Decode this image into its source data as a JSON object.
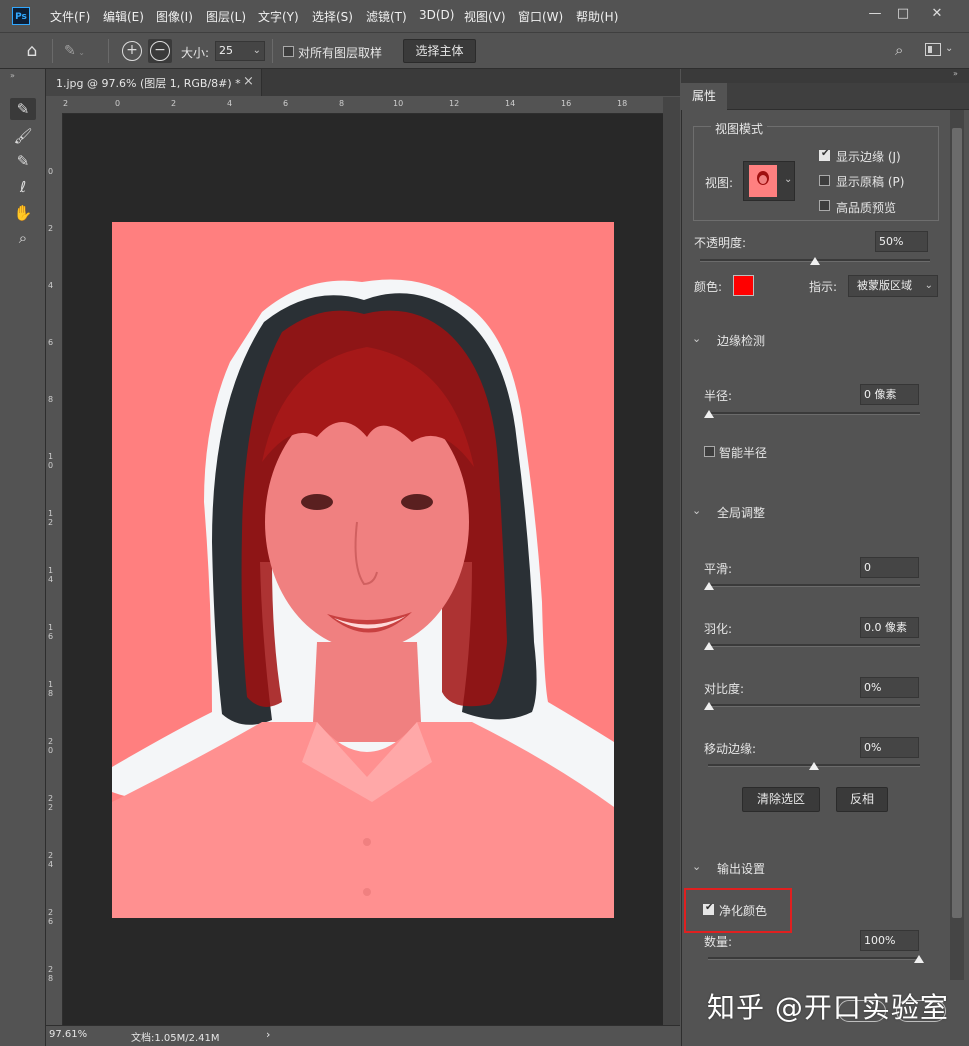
{
  "menu": {
    "items": [
      "文件(F)",
      "编辑(E)",
      "图像(I)",
      "图层(L)",
      "文字(Y)",
      "选择(S)",
      "滤镜(T)",
      "3D(D)",
      "视图(V)",
      "窗口(W)",
      "帮助(H)"
    ],
    "logo": "Ps"
  },
  "options": {
    "size_label": "大小:",
    "size_value": "25",
    "sample_all_layers": "对所有图层取样",
    "select_subject": "选择主体"
  },
  "document": {
    "tab_title": "1.jpg @ 97.6% (图层 1, RGB/8#) *",
    "tab_close": "×",
    "zoom": "97.61%",
    "doc_info": "文档:1.05M/2.41M",
    "status_arrow": "›"
  },
  "rulers": {
    "h_labels": [
      "2",
      "0",
      "2",
      "4",
      "6",
      "8",
      "10",
      "12",
      "14",
      "16",
      "18"
    ],
    "v_labels": [
      "0",
      "2",
      "4",
      "6",
      "8",
      "10",
      "12",
      "14",
      "16",
      "18",
      "20",
      "22",
      "24",
      "26",
      "28"
    ]
  },
  "panel": {
    "tab": "属性",
    "view_mode": {
      "title": "视图模式",
      "view_label": "视图:",
      "show_edge": "显示边缘 (J)",
      "show_original": "显示原稿 (P)",
      "high_quality": "高品质预览"
    },
    "opacity_label": "不透明度:",
    "opacity_value": "50%",
    "color_label": "颜色:",
    "indicate_label": "指示:",
    "indicate_value": "被蒙版区域",
    "edge_detection": {
      "title": "边缘检测",
      "radius_label": "半径:",
      "radius_value": "0 像素",
      "smart_radius": "智能半径"
    },
    "global": {
      "title": "全局调整",
      "smooth_label": "平滑:",
      "smooth_value": "0",
      "feather_label": "羽化:",
      "feather_value": "0.0 像素",
      "contrast_label": "对比度:",
      "contrast_value": "0%",
      "shift_label": "移动边缘:",
      "shift_value": "0%",
      "clear_button": "清除选区",
      "invert_button": "反相"
    },
    "output": {
      "title": "输出设置",
      "decontaminate": "净化颜色",
      "amount_label": "数量:",
      "amount_value": "100%"
    }
  },
  "watermark": "知乎 @开口实验室",
  "colors": {
    "overlay": "#ff0000",
    "highlight_box": "#e02020"
  }
}
